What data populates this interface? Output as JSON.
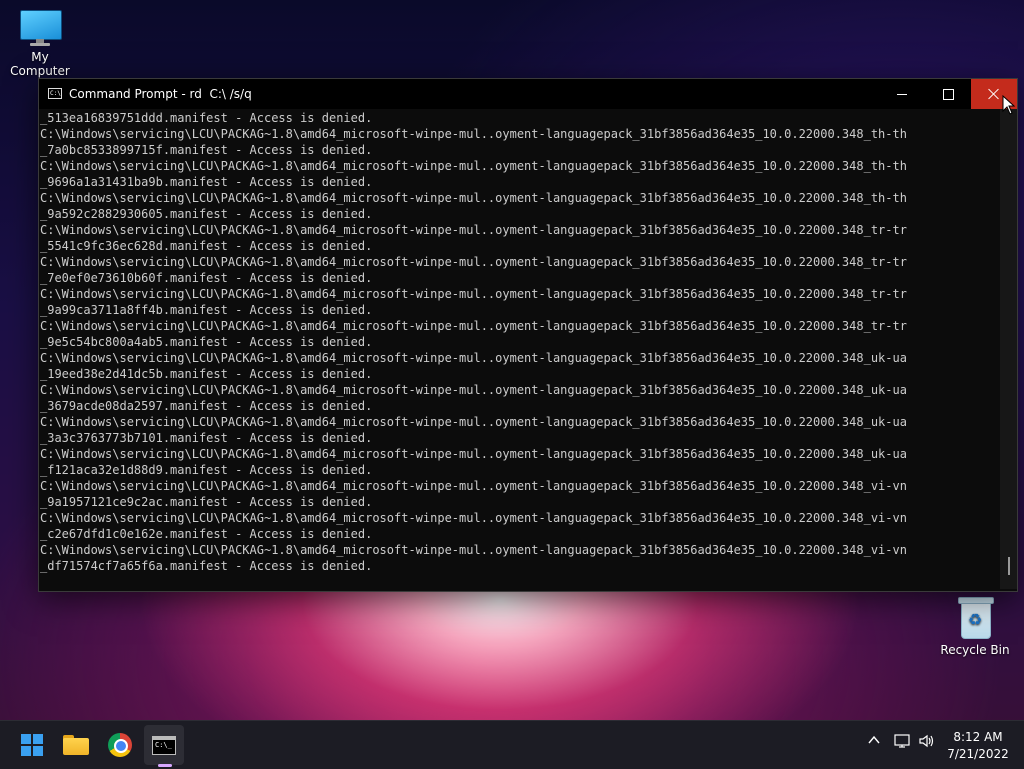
{
  "desktop": {
    "icons": [
      {
        "label": "My Computer",
        "icon": "computer-icon"
      },
      {
        "label": "Recycle Bin",
        "icon": "recycle-bin-icon"
      }
    ]
  },
  "window": {
    "title": "Command Prompt - rd  C:\\ /s/q",
    "buttons": {
      "minimize": "minimize",
      "maximize": "maximize",
      "close": "close"
    }
  },
  "console": {
    "lines": [
      "_513ea16839751ddd.manifest - Access is denied.",
      "C:\\Windows\\servicing\\LCU\\PACKAG~1.8\\amd64_microsoft-winpe-mul..oyment-languagepack_31bf3856ad364e35_10.0.22000.348_th-th",
      "_7a0bc8533899715f.manifest - Access is denied.",
      "C:\\Windows\\servicing\\LCU\\PACKAG~1.8\\amd64_microsoft-winpe-mul..oyment-languagepack_31bf3856ad364e35_10.0.22000.348_th-th",
      "_9696a1a31431ba9b.manifest - Access is denied.",
      "C:\\Windows\\servicing\\LCU\\PACKAG~1.8\\amd64_microsoft-winpe-mul..oyment-languagepack_31bf3856ad364e35_10.0.22000.348_th-th",
      "_9a592c2882930605.manifest - Access is denied.",
      "C:\\Windows\\servicing\\LCU\\PACKAG~1.8\\amd64_microsoft-winpe-mul..oyment-languagepack_31bf3856ad364e35_10.0.22000.348_tr-tr",
      "_5541c9fc36ec628d.manifest - Access is denied.",
      "C:\\Windows\\servicing\\LCU\\PACKAG~1.8\\amd64_microsoft-winpe-mul..oyment-languagepack_31bf3856ad364e35_10.0.22000.348_tr-tr",
      "_7e0ef0e73610b60f.manifest - Access is denied.",
      "C:\\Windows\\servicing\\LCU\\PACKAG~1.8\\amd64_microsoft-winpe-mul..oyment-languagepack_31bf3856ad364e35_10.0.22000.348_tr-tr",
      "_9a99ca3711a8ff4b.manifest - Access is denied.",
      "C:\\Windows\\servicing\\LCU\\PACKAG~1.8\\amd64_microsoft-winpe-mul..oyment-languagepack_31bf3856ad364e35_10.0.22000.348_tr-tr",
      "_9e5c54bc800a4ab5.manifest - Access is denied.",
      "C:\\Windows\\servicing\\LCU\\PACKAG~1.8\\amd64_microsoft-winpe-mul..oyment-languagepack_31bf3856ad364e35_10.0.22000.348_uk-ua",
      "_19eed38e2d41dc5b.manifest - Access is denied.",
      "C:\\Windows\\servicing\\LCU\\PACKAG~1.8\\amd64_microsoft-winpe-mul..oyment-languagepack_31bf3856ad364e35_10.0.22000.348_uk-ua",
      "_3679acde08da2597.manifest - Access is denied.",
      "C:\\Windows\\servicing\\LCU\\PACKAG~1.8\\amd64_microsoft-winpe-mul..oyment-languagepack_31bf3856ad364e35_10.0.22000.348_uk-ua",
      "_3a3c3763773b7101.manifest - Access is denied.",
      "C:\\Windows\\servicing\\LCU\\PACKAG~1.8\\amd64_microsoft-winpe-mul..oyment-languagepack_31bf3856ad364e35_10.0.22000.348_uk-ua",
      "_f121aca32e1d88d9.manifest - Access is denied.",
      "C:\\Windows\\servicing\\LCU\\PACKAG~1.8\\amd64_microsoft-winpe-mul..oyment-languagepack_31bf3856ad364e35_10.0.22000.348_vi-vn",
      "_9a1957121ce9c2ac.manifest - Access is denied.",
      "C:\\Windows\\servicing\\LCU\\PACKAG~1.8\\amd64_microsoft-winpe-mul..oyment-languagepack_31bf3856ad364e35_10.0.22000.348_vi-vn",
      "_c2e67dfd1c0e162e.manifest - Access is denied.",
      "C:\\Windows\\servicing\\LCU\\PACKAG~1.8\\amd64_microsoft-winpe-mul..oyment-languagepack_31bf3856ad364e35_10.0.22000.348_vi-vn",
      "_df71574cf7a65f6a.manifest - Access is denied."
    ]
  },
  "taskbar": {
    "apps": [
      {
        "name": "start",
        "icon": "windows-logo-icon"
      },
      {
        "name": "file-explorer",
        "icon": "folder-icon"
      },
      {
        "name": "chrome",
        "icon": "chrome-icon"
      },
      {
        "name": "command-prompt",
        "icon": "cmd-icon",
        "active": true
      }
    ],
    "tray": {
      "chevron": "^",
      "network": "network-icon",
      "volume": "volume-icon"
    },
    "clock": {
      "time": "8:12 AM",
      "date": "7/21/2022"
    }
  },
  "colors": {
    "close_button": "#c42b1c",
    "console_bg": "#0c0c0c",
    "console_text": "#cccccc",
    "accent": "#3aa0f0"
  }
}
